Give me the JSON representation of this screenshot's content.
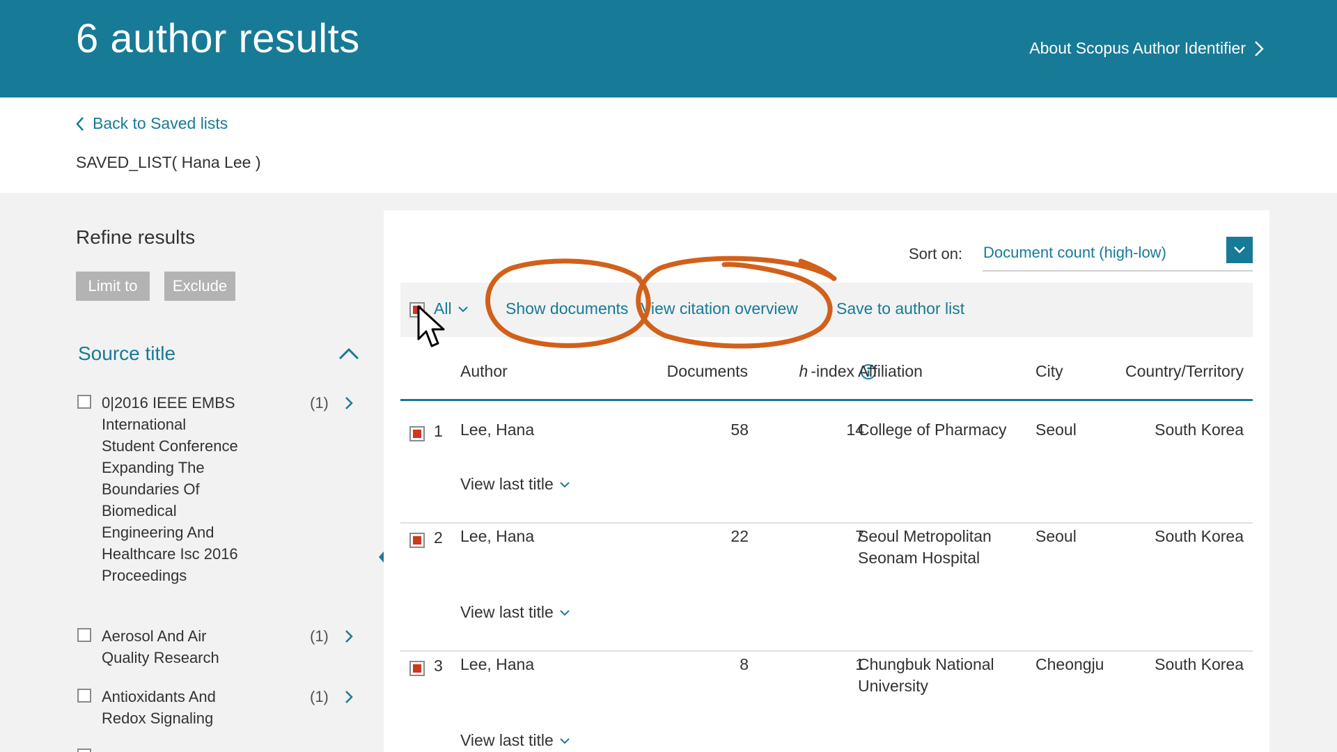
{
  "header": {
    "title": "6 author results",
    "about_link": "About Scopus Author Identifier"
  },
  "subheader": {
    "back_link": "Back to Saved lists",
    "saved_list": "SAVED_LIST( Hana Lee )"
  },
  "sidebar": {
    "refine_title": "Refine results",
    "limit_label": "Limit to",
    "exclude_label": "Exclude",
    "section_title": "Source title",
    "facets": [
      {
        "name": "0|2016 IEEE EMBS International Student Conference Expanding The Boundaries Of Biomedical Engineering And Healthcare Isc 2016 Proceedings",
        "count": "(1)"
      },
      {
        "name": "Aerosol And Air Quality Research",
        "count": "(1)"
      },
      {
        "name": "Antioxidants And Redox Signaling",
        "count": "(1)"
      }
    ]
  },
  "sort": {
    "label": "Sort on:",
    "value": "Document count (high-low)"
  },
  "toolbar": {
    "all_label": "All",
    "show_documents": "Show documents",
    "view_citation": "View citation overview",
    "save_to_list": "Save to author list"
  },
  "columns": {
    "author": "Author",
    "documents": "Documents",
    "hindex_h": "h",
    "hindex_rest": "-index",
    "affiliation": "Affiliation",
    "city": "City",
    "country": "Country/Territory"
  },
  "rows": [
    {
      "num": "1",
      "author": "Lee, Hana",
      "documents": "58",
      "hindex": "14",
      "affiliation": "College of Pharmacy",
      "city": "Seoul",
      "country": "South Korea",
      "view_last": "View last title"
    },
    {
      "num": "2",
      "author": "Lee, Hana",
      "documents": "22",
      "hindex": "7",
      "affiliation": "Seoul Metropolitan Seonam Hospital",
      "city": "Seoul",
      "country": "South Korea",
      "view_last": "View last title"
    },
    {
      "num": "3",
      "author": "Lee, Hana",
      "documents": "8",
      "hindex": "1",
      "affiliation": "Chungbuk National University",
      "city": "Cheongju",
      "country": "South Korea",
      "view_last": "View last title"
    }
  ],
  "colors": {
    "brand": "#177a96",
    "annotation": "#d2601a",
    "checked": "#c93a1e"
  }
}
